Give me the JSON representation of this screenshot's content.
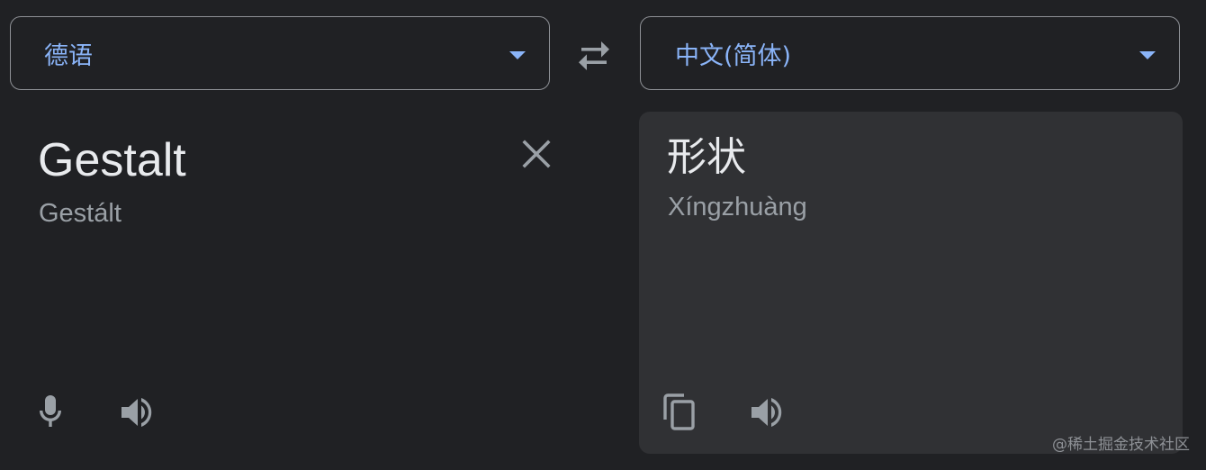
{
  "source": {
    "language": "德语",
    "text": "Gestalt",
    "transliteration": "Gestált"
  },
  "target": {
    "language": "中文(简体)",
    "text": "形状",
    "transliteration": "Xíngzhuàng"
  },
  "icons": {
    "swap": "swap-arrows-icon",
    "clear": "close-icon",
    "mic": "microphone-icon",
    "speaker": "speaker-icon",
    "copy": "copy-icon"
  },
  "colors": {
    "background": "#202124",
    "panel": "#303134",
    "accent": "#8ab4f8",
    "text": "#e8eaed",
    "muted": "#9aa0a6"
  },
  "watermark": "@稀土掘金技术社区"
}
